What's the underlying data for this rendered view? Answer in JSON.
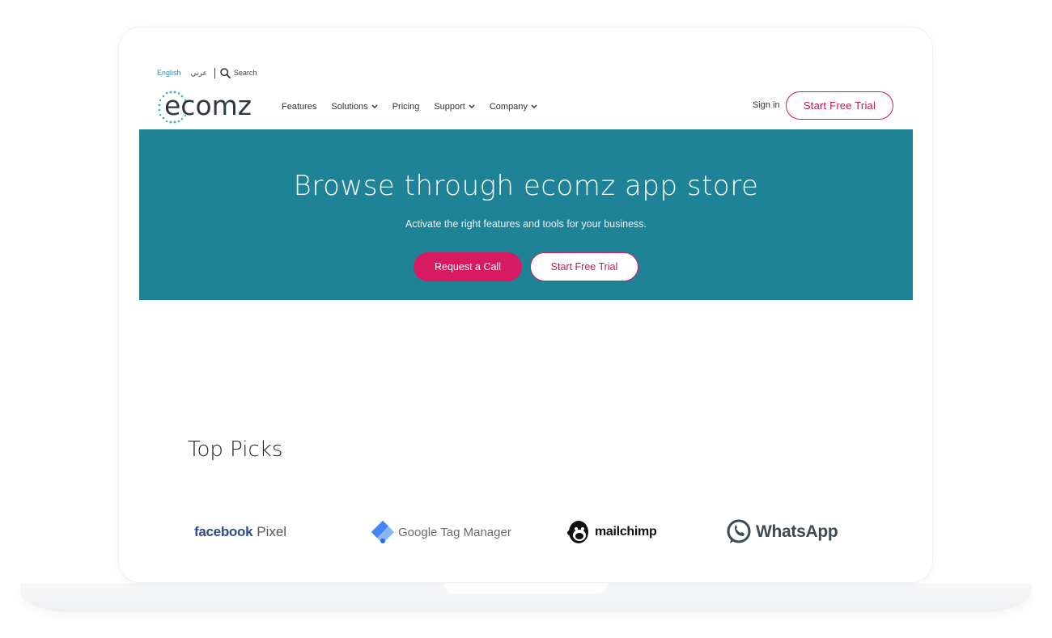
{
  "utility_bar": {
    "lang_english": "English",
    "lang_arabic": "عربي",
    "search_label": "Search",
    "search_icon": "search-icon"
  },
  "brand": {
    "logo_text": "ecomz"
  },
  "nav": {
    "items": [
      {
        "label": "Features",
        "has_dropdown": false
      },
      {
        "label": "Solutions",
        "has_dropdown": true
      },
      {
        "label": "Pricing",
        "has_dropdown": false
      },
      {
        "label": "Support",
        "has_dropdown": true
      },
      {
        "label": "Company",
        "has_dropdown": true
      }
    ],
    "signin_label": "Sign in",
    "trial_label": "Start Free Trial"
  },
  "hero": {
    "title": "Browse through ecomz app store",
    "subtitle": "Activate the right features and tools for your business.",
    "primary_button": "Request a Call",
    "secondary_button": "Start Free Trial"
  },
  "top_picks": {
    "title": "Top Picks",
    "brands": [
      {
        "name_part1": "facebook",
        "name_part2": "Pixel"
      },
      {
        "name": "Google Tag Manager"
      },
      {
        "name": "mailchimp"
      },
      {
        "name": "WhatsApp"
      }
    ]
  },
  "colors": {
    "hero_background": "#1f8398",
    "accent": "#d81b60",
    "lang_active": "#2f8fa3"
  }
}
